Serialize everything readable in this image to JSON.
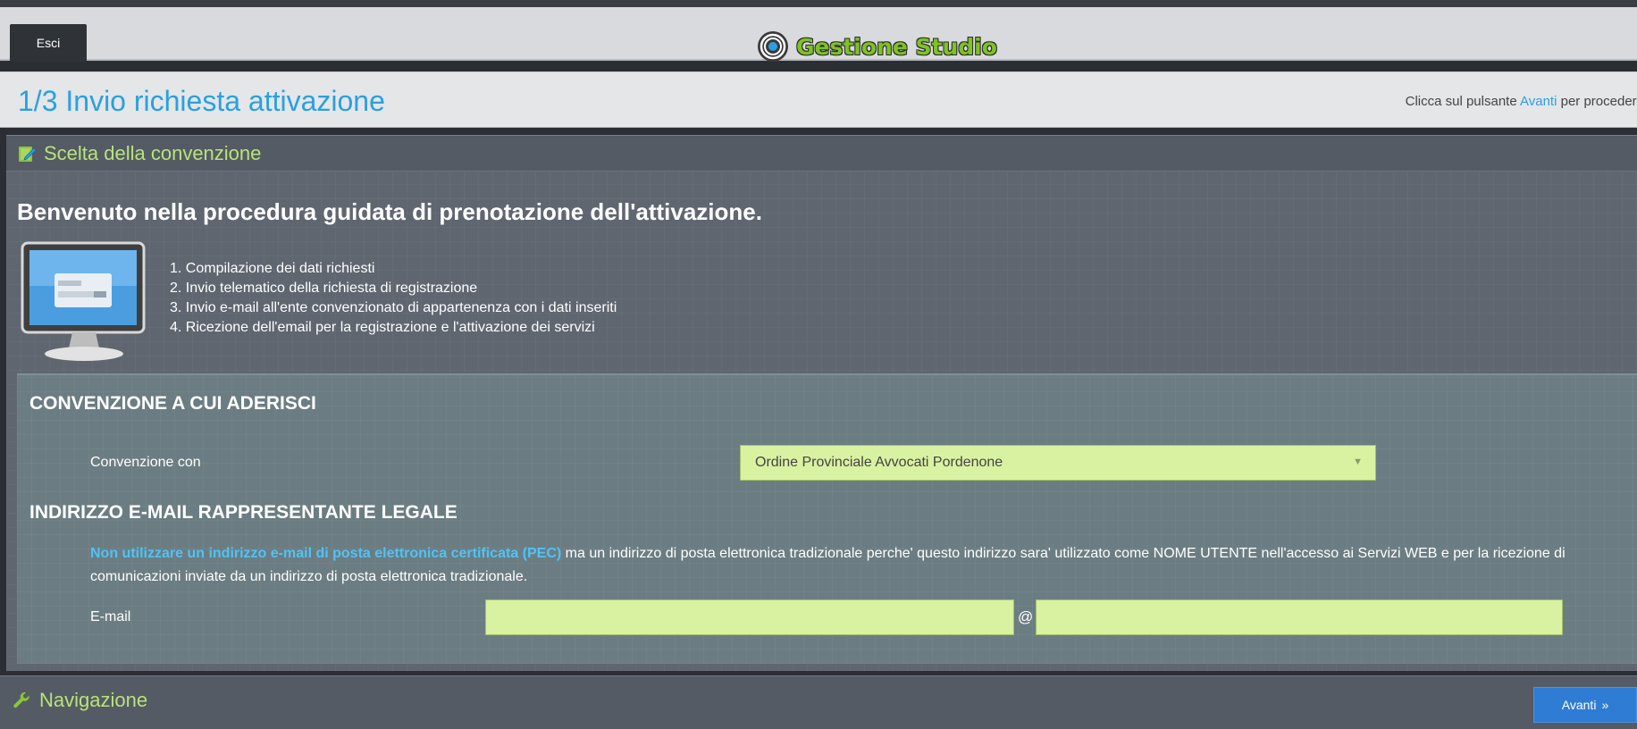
{
  "header": {
    "logout_label": "Esci",
    "app_name": "Gestione Studio"
  },
  "step": {
    "title": "1/3 Invio richiesta attivazione",
    "hint_before": "Clicca sul pulsante ",
    "hint_link": "Avanti",
    "hint_after": " per procedere"
  },
  "section": {
    "title": "Scelta della convenzione",
    "welcome": "Benvenuto nella procedura guidata di prenotazione dell'attivazione.",
    "steps": [
      "1. Compilazione dei dati richiesti",
      "2. Invio telematico della richiesta di registrazione",
      "3. Invio e-mail all'ente convenzionato di appartenenza con i dati inseriti",
      "4. Ricezione dell'email per la registrazione e l'attivazione dei servizi"
    ]
  },
  "convention": {
    "heading": "CONVENZIONE A CUI ADERISCI",
    "label": "Convenzione con",
    "selected": "Ordine Provinciale Avvocati Pordenone"
  },
  "email": {
    "heading": "INDIRIZZO E-MAIL RAPPRESENTANTE LEGALE",
    "notice_highlight": "Non utilizzare un indirizzo e-mail di posta elettronica certificata (PEC)",
    "notice_rest": " ma un indirizzo di posta elettronica tradizionale perche' questo indirizzo sara' utilizzato come NOME UTENTE nell'accesso ai Servizi WEB e per la ricezione di comunicazioni inviate da un indirizzo di posta elettronica tradizionale.",
    "label": "E-mail",
    "at": "@",
    "local_value": "",
    "domain_value": ""
  },
  "navigation": {
    "title": "Navigazione",
    "next_label": "Avanti",
    "next_icon": "»"
  },
  "colors": {
    "accent_blue": "#2aa0e0",
    "section_green": "#b9e27a",
    "input_green": "#d9f2a1",
    "button_blue": "#2f7cd4"
  }
}
